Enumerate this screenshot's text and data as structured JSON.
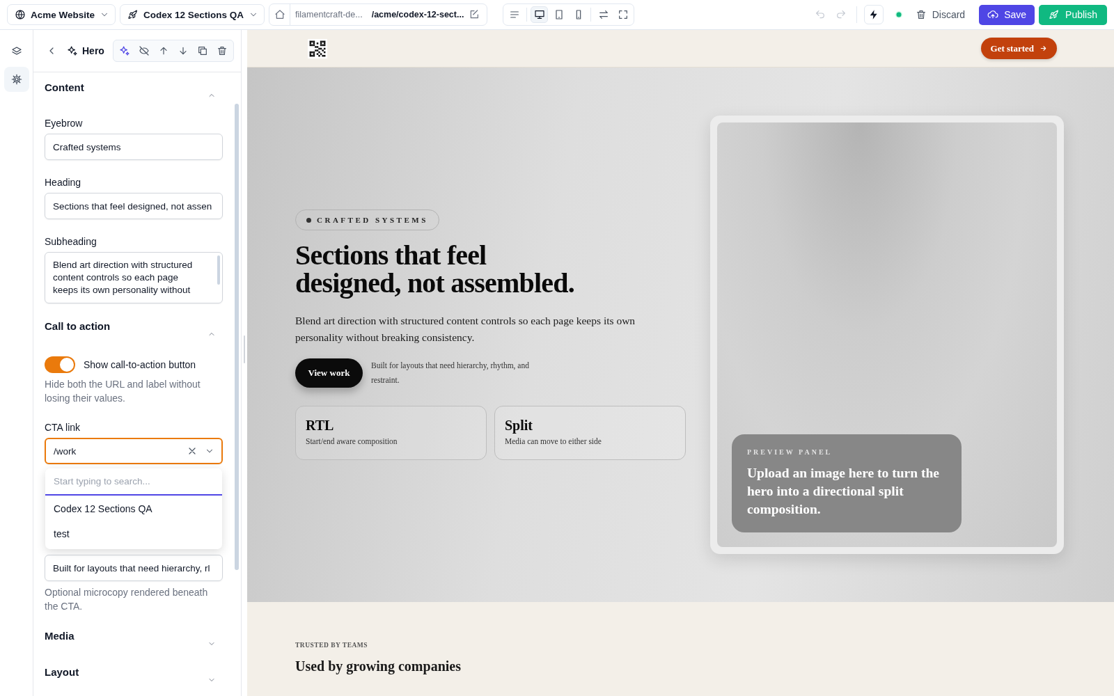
{
  "topbar": {
    "site": "Acme Website",
    "project": "Codex 12 Sections QA",
    "url_domain": "filamentcraft-de...",
    "url_path": "/acme/codex-12-sect...",
    "view_modes": [
      {
        "selected": true
      },
      {
        "selected": false
      },
      {
        "selected": false
      }
    ],
    "discard": "Discard",
    "save": "Save",
    "publish": "Publish"
  },
  "rail": [
    {
      "selected": false
    },
    {
      "selected": true
    }
  ],
  "panel": {
    "title": "Hero",
    "sections": [
      {
        "title": "Content",
        "expanded": true,
        "fields": [
          {
            "kind": "text",
            "label": "Eyebrow",
            "value": "Crafted systems"
          },
          {
            "kind": "text",
            "label": "Heading",
            "value": "Sections that feel designed, not assen"
          },
          {
            "kind": "textarea",
            "label": "Subheading",
            "value": "Blend art direction with structured content controls so each page keeps its own personality without"
          }
        ]
      },
      {
        "title": "Call to action",
        "expanded": true,
        "fields": [
          {
            "kind": "toggle",
            "label": "Show call-to-action button",
            "on": true,
            "help": "Hide both the URL and label without losing their values."
          },
          {
            "kind": "combo",
            "label": "CTA link",
            "value": "/work",
            "open": true,
            "search_placeholder": "Start typing to search...",
            "options": [
              {
                "label": "Codex 12 Sections QA"
              },
              {
                "label": "test"
              }
            ]
          },
          {
            "kind": "text",
            "value": "Built for layouts that need hierarchy, rl",
            "help": "Optional microcopy rendered beneath the CTA."
          }
        ]
      },
      {
        "title": "Media",
        "expanded": false
      },
      {
        "title": "Layout",
        "expanded": false
      }
    ]
  },
  "preview": {
    "nav_button": "Get started",
    "badge": "CRAFTED SYSTEMS",
    "heading": "Sections that feel designed, not assembled.",
    "body": "Blend art direction with structured content controls so each page keeps its own personality without breaking consistency.",
    "cta": "View work",
    "cta_note": "Built for layouts that need hierarchy, rhythm, and restraint.",
    "cards": [
      {
        "title": "RTL",
        "text": "Start/end aware composition"
      },
      {
        "title": "Split",
        "text": "Media can move to either side"
      }
    ],
    "media": {
      "label": "PREVIEW PANEL",
      "text": "Upload an image here to turn the hero into a directional split composition."
    },
    "trusted": {
      "eyebrow": "TRUSTED BY TEAMS",
      "heading": "Used by growing companies"
    }
  }
}
